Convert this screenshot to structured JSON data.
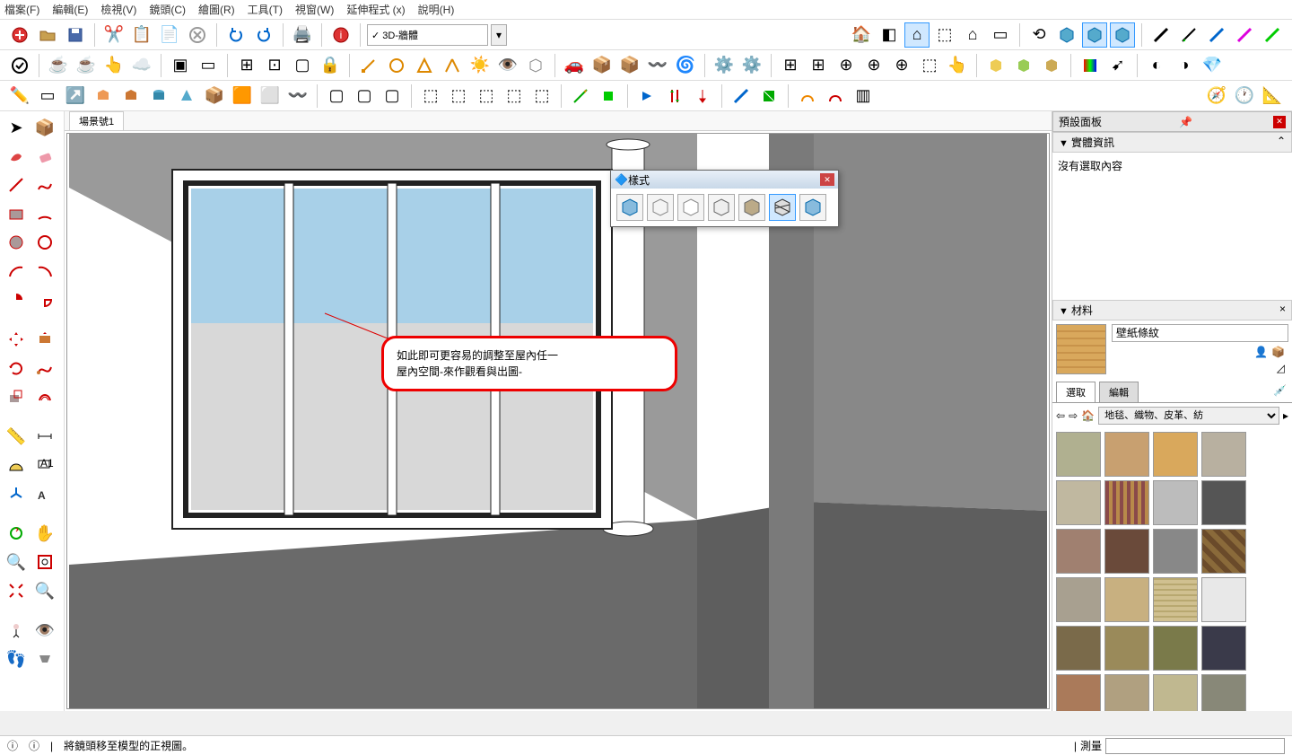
{
  "menu": {
    "items": [
      "檔案(F)",
      "編輯(E)",
      "檢視(V)",
      "鏡頭(C)",
      "繪圖(R)",
      "工具(T)",
      "視窗(W)",
      "延伸程式 (x)",
      "說明(H)"
    ]
  },
  "toolbar": {
    "combo_value": "✓  3D-牆體"
  },
  "scene_tab": "場景號1",
  "default_tray": {
    "title": "預設面板"
  },
  "entity_info": {
    "title": "實體資訊",
    "body": "沒有選取內容"
  },
  "materials": {
    "title": "材料",
    "current_name": "壁紙條紋",
    "tab_select": "選取",
    "tab_edit": "編輯",
    "category": "地毯、織物、皮革、紡"
  },
  "style_float": {
    "title": "樣式"
  },
  "bubble": {
    "line1": "如此即可更容易的調整至屋內任一",
    "line2": "屋內空間-來作觀看與出圖-"
  },
  "status": {
    "hint": "將鏡頭移至模型的正視圖。",
    "measure_label": "測量",
    "separator": "|"
  },
  "mat_colors": [
    "#b0b090",
    "#c8a070",
    "#d9a85c",
    "#b8b0a0",
    "#c0b8a0",
    "repeating-linear-gradient(90deg,#8a4a4a 0 4px,#b88a4a 4px 8px)",
    "#bcbcbc",
    "#555",
    "#a08070",
    "#6a4a3a",
    "#888",
    "repeating-linear-gradient(45deg,#8a6a3a 0 6px,#6a4a2a 6px 12px)",
    "#a8a090",
    "#c8b080",
    "repeating-linear-gradient(0deg,#d0c090 0 4px,#b8a870 4px 6px)",
    "#e8e8e8",
    "#7a6a4a",
    "#9a8a5a",
    "#7a7a4a",
    "#3a3a4a",
    "#aa7a5a",
    "#b0a080",
    "#c0b890",
    "#888878"
  ]
}
